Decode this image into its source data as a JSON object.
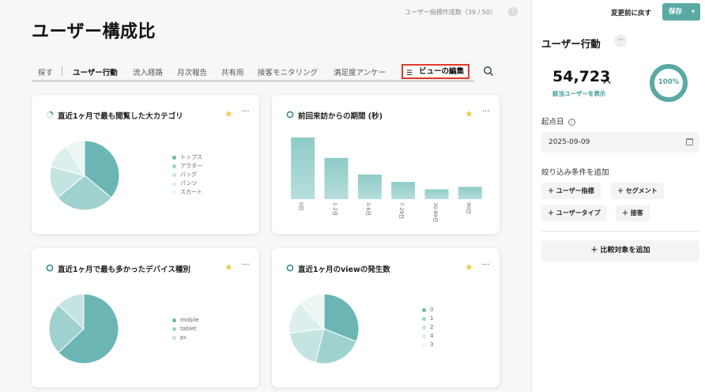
{
  "header": {
    "title": "ユーザー構成比",
    "metric_count": "ユーザー指標作成数（39 / 50）",
    "help": "?"
  },
  "tabs": [
    {
      "label": "探す",
      "active": false
    },
    {
      "label": "ユーザー行動",
      "active": true
    },
    {
      "label": "流入経路",
      "active": false
    },
    {
      "label": "月次報告",
      "active": false
    },
    {
      "label": "共有用",
      "active": false
    },
    {
      "label": "接客モニタリング",
      "active": false
    },
    {
      "label": "満足度アンケー",
      "active": false
    }
  ],
  "edit_view_label": "ビューの編集",
  "cards": [
    {
      "title": "直近1ヶ月で最も閲覧した大カテゴリ",
      "chart_data": {
        "type": "pie",
        "categories": [
          "トップス",
          "アウター",
          "バッグ",
          "パンツ",
          "スカート"
        ],
        "values": [
          36,
          28,
          15,
          12,
          9
        ]
      }
    },
    {
      "title": "前回来訪からの期間 (秒)",
      "chart_data": {
        "type": "bar",
        "categories": [
          "0日",
          "1-2日",
          "3-6日",
          "7-29日",
          "30-89日",
          "90日"
        ],
        "values": [
          100,
          67,
          40,
          28,
          16,
          20
        ]
      }
    },
    {
      "title": "直近1ヶ月で最も多かったデバイス種別",
      "chart_data": {
        "type": "pie",
        "categories": [
          "mobile",
          "tablet",
          "pc"
        ],
        "values": [
          63,
          24,
          13
        ]
      }
    },
    {
      "title": "直近1ヶ月のviewの発生数",
      "chart_data": {
        "type": "pie",
        "categories": [
          "0",
          "1",
          "2",
          "4",
          "3"
        ],
        "values": [
          31,
          23,
          19,
          15,
          12
        ]
      }
    }
  ],
  "colors": [
    "#6bb6b4",
    "#9fd2cf",
    "#c4e4e2",
    "#dcefee",
    "#ebf6f5"
  ],
  "sidebar": {
    "revert_label": "変更前に戻す",
    "save_label": "保存",
    "title": "ユーザー行動",
    "more": "···",
    "user_count": "54,723",
    "user_unit": "人",
    "show_users": "該当ユーザーを表示",
    "ratio": "100%",
    "ratio_value": 1.0,
    "start_date_label": "起点日",
    "start_date": "2025-09-09",
    "filter_label": "絞り込み条件を追加",
    "filters": [
      "＋ ユーザー指標",
      "＋ セグメント",
      "＋ ユーザータイプ",
      "＋ 接客"
    ],
    "compare_label": "＋ 比較対象を追加"
  }
}
